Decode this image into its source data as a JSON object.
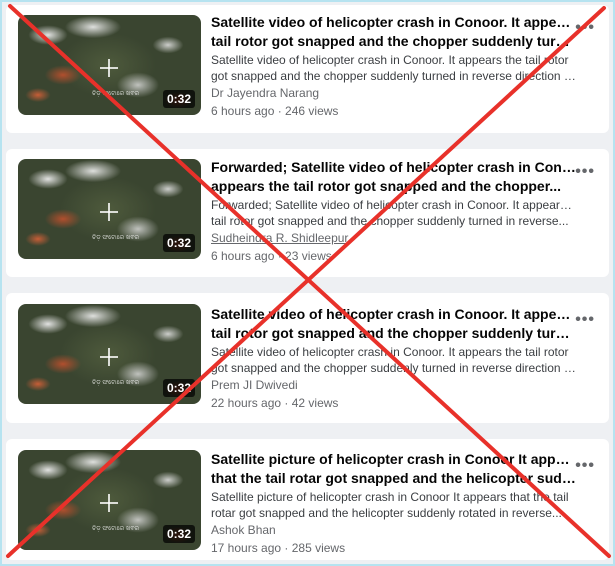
{
  "videos": [
    {
      "duration": "0:32",
      "watermark": "ଚିଡ଼ ଫଟୋରେ ଖବର",
      "title_line1": "Satellite video of helicopter crash in Conoor. It appears the",
      "title_line2": "tail rotor got snapped and the chopper suddenly turned i...",
      "desc_line1": "Satellite video of helicopter crash in Conoor. It appears the tail rotor",
      "desc_line2": "got snapped and the chopper suddenly turned in reverse direction an...",
      "author": "Dr Jayendra Narang",
      "meta": "6 hours ago · 246 views"
    },
    {
      "duration": "0:32",
      "watermark": "ଚିଡ଼ ଫଟୋରେ ଖବର",
      "title_line1": "Forwarded; Satellite video of helicopter crash in Conoor. It",
      "title_line2": "appears the tail rotor got snapped and the chopper...",
      "desc_line1": "Forwarded; Satellite video of helicopter crash in Conoor. It appears the",
      "desc_line2": "tail rotor got snapped and the chopper suddenly turned in reverse...",
      "author": "Sudheindra R. Shidleepur",
      "meta": "6 hours ago · 23 views"
    },
    {
      "duration": "0:32",
      "watermark": "ଚିଡ଼ ଫଟୋରେ ଖବର",
      "title_line1": "Satellite video of helicopter crash in Conoor. It appears the",
      "title_line2": "tail rotor got snapped and the chopper suddenly turned i...",
      "desc_line1": "Satellite video of helicopter crash in Conoor. It appears the tail rotor",
      "desc_line2": "got snapped and the chopper suddenly turned in reverse direction an...",
      "author": "Prem JI Dwivedi",
      "meta": "22 hours ago · 42 views"
    },
    {
      "duration": "0:32",
      "watermark": "ଚିଡ଼ ଫଟୋରେ ଖବର",
      "title_line1": "Satellite picture of helicopter crash in Conoor It appears",
      "title_line2": "that the tail rotar got snapped and the helicopter suddenl...",
      "desc_line1": "Satellite picture of helicopter crash in Conoor It appears that the tail",
      "desc_line2": "rotar got snapped and the helicopter suddenly rotated in reverse...",
      "author": "Ashok Bhan",
      "meta": "17 hours ago · 285 views"
    }
  ],
  "more_glyph": "•••",
  "overlay": {
    "mark": "red-x",
    "color": "#e8312a"
  }
}
